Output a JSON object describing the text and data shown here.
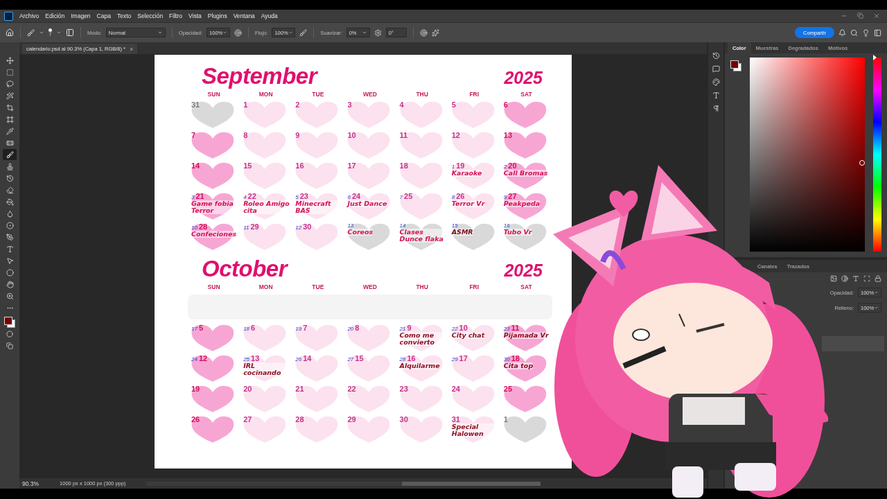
{
  "menu": [
    "Archivo",
    "Edición",
    "Imagen",
    "Capa",
    "Texto",
    "Selección",
    "Filtro",
    "Vista",
    "Plugins",
    "Ventana",
    "Ayuda"
  ],
  "options_bar": {
    "brush_size": "7",
    "mode_label": "Modo:",
    "mode": "Normal",
    "opacity_label": "Opacidad:",
    "opacity": "100%",
    "flow_label": "Flujo:",
    "flow": "100%",
    "smoothing_label": "Suavizar:",
    "smoothing": "0%",
    "angle": "0°",
    "share": "Compartir"
  },
  "document_tab": {
    "title": "calendario.psd al 90.3% (Capa 1, RGB/8) *",
    "close": "×"
  },
  "toolbox": [
    {
      "kind": "move",
      "selected": false
    },
    {
      "kind": "marquee",
      "selected": false
    },
    {
      "kind": "lasso",
      "selected": false
    },
    {
      "kind": "wand",
      "selected": false
    },
    {
      "kind": "crop",
      "selected": false
    },
    {
      "kind": "frame",
      "selected": false
    },
    {
      "kind": "eyedropper",
      "selected": false
    },
    {
      "kind": "healing",
      "selected": false
    },
    {
      "kind": "brush",
      "selected": true
    },
    {
      "kind": "stamp",
      "selected": false
    },
    {
      "kind": "history",
      "selected": false
    },
    {
      "kind": "eraser",
      "selected": false
    },
    {
      "kind": "bucket",
      "selected": false
    },
    {
      "kind": "blur",
      "selected": false
    },
    {
      "kind": "dodge",
      "selected": false
    },
    {
      "kind": "pen",
      "selected": false
    },
    {
      "kind": "type",
      "selected": false
    },
    {
      "kind": "select",
      "selected": false
    },
    {
      "kind": "shape",
      "selected": false
    },
    {
      "kind": "hand",
      "selected": false
    },
    {
      "kind": "zoom",
      "selected": false
    },
    {
      "kind": "more",
      "selected": false
    }
  ],
  "calendar": [
    {
      "name": "September",
      "year": "2025",
      "erased_band": false,
      "weekdays": [
        "SUN",
        "MON",
        "TUE",
        "WED",
        "THU",
        "FRI",
        "SAT"
      ],
      "weeks": [
        {
          "days": [
            {
              "kind": "other",
              "number": "31"
            },
            {
              "kind": "weekday",
              "number": "1"
            },
            {
              "kind": "weekday",
              "number": "2"
            },
            {
              "kind": "weekday",
              "number": "3"
            },
            {
              "kind": "weekday",
              "number": "4"
            },
            {
              "kind": "weekday",
              "number": "5"
            },
            {
              "kind": "weekend",
              "number": "6"
            }
          ]
        },
        {
          "days": [
            {
              "kind": "weekend",
              "number": "7"
            },
            {
              "kind": "weekday",
              "number": "8"
            },
            {
              "kind": "weekday",
              "number": "9"
            },
            {
              "kind": "weekday",
              "number": "10"
            },
            {
              "kind": "weekday",
              "number": "11"
            },
            {
              "kind": "weekday",
              "number": "12"
            },
            {
              "kind": "weekend",
              "number": "13"
            }
          ]
        },
        {
          "days": [
            {
              "kind": "weekend",
              "number": "14"
            },
            {
              "kind": "weekday",
              "number": "15"
            },
            {
              "kind": "weekday",
              "number": "16"
            },
            {
              "kind": "weekday",
              "number": "17"
            },
            {
              "kind": "weekday",
              "number": "18"
            },
            {
              "kind": "weekday",
              "number": "19",
              "mark": "1",
              "note": "Karaoke",
              "color": "#d41356"
            },
            {
              "kind": "weekend",
              "number": "20",
              "mark": "2",
              "note": "Call Bromas",
              "color": "#d41356"
            }
          ]
        },
        {
          "days": [
            {
              "kind": "weekend",
              "number": "21",
              "mark": "3",
              "note": "Game fobia Terror",
              "color": "#d41356"
            },
            {
              "kind": "weekday",
              "number": "22",
              "mark": "4",
              "note": "Roleo Amigo cita",
              "color": "#d41356"
            },
            {
              "kind": "weekday",
              "number": "23",
              "mark": "5",
              "note": "Minecraft BAS",
              "color": "#d41356"
            },
            {
              "kind": "weekday",
              "number": "24",
              "mark": "6",
              "note": "Just Dance",
              "color": "#d41356"
            },
            {
              "kind": "weekday",
              "number": "25",
              "mark": "7"
            },
            {
              "kind": "weekday",
              "number": "26",
              "mark": "8",
              "note": "Terror Vr",
              "color": "#d41356"
            },
            {
              "kind": "weekend",
              "number": "27",
              "mark": "9",
              "note": "Peakpeda",
              "color": "#d41356"
            }
          ]
        },
        {
          "days": [
            {
              "kind": "weekend",
              "number": "28",
              "mark": "10",
              "note": "Confeciones",
              "color": "#d41356"
            },
            {
              "kind": "weekday",
              "number": "29",
              "mark": "11"
            },
            {
              "kind": "weekday",
              "number": "30",
              "mark": "12"
            },
            {
              "kind": "other",
              "mark": "13",
              "note": "Coreos",
              "color": "#d41356"
            },
            {
              "kind": "other",
              "mark": "14",
              "note": "Clases Dunce flaka",
              "color": "#d41356"
            },
            {
              "kind": "other",
              "mark": "15",
              "note": "ASMR",
              "color": "#7a0a1a"
            },
            {
              "kind": "other",
              "mark": "16",
              "note": "Tubo Vr",
              "color": "#d41356"
            }
          ]
        }
      ]
    },
    {
      "name": "October",
      "year": "2025",
      "erased_band": true,
      "weekdays": [
        "SUN",
        "MON",
        "TUE",
        "WED",
        "THU",
        "FRI",
        "SAT"
      ],
      "weeks": [
        {
          "days": [
            {
              "kind": "weekend",
              "number": "5",
              "mark": "17"
            },
            {
              "kind": "weekday",
              "number": "6",
              "mark": "18"
            },
            {
              "kind": "weekday",
              "number": "7",
              "mark": "19"
            },
            {
              "kind": "weekday",
              "number": "8",
              "mark": "20"
            },
            {
              "kind": "weekday",
              "number": "9",
              "mark": "21",
              "note": "Como me convierto",
              "color": "#8b0f1f"
            },
            {
              "kind": "weekday",
              "number": "10",
              "mark": "22",
              "note": "City chat",
              "color": "#8b0f1f"
            },
            {
              "kind": "weekend",
              "number": "11",
              "mark": "23",
              "note": "Pijamada Vr",
              "color": "#8b0f1f"
            }
          ]
        },
        {
          "days": [
            {
              "kind": "weekend",
              "number": "12",
              "mark": "24"
            },
            {
              "kind": "weekday",
              "number": "13",
              "mark": "25",
              "note": "IRL cocinando",
              "color": "#8b0f1f"
            },
            {
              "kind": "weekday",
              "number": "14",
              "mark": "26"
            },
            {
              "kind": "weekday",
              "number": "15",
              "mark": "27"
            },
            {
              "kind": "weekday",
              "number": "16",
              "mark": "28",
              "note": "Alquilarme",
              "color": "#8b0f1f"
            },
            {
              "kind": "weekday",
              "number": "17",
              "mark": "29"
            },
            {
              "kind": "weekend",
              "number": "18",
              "mark": "30",
              "note": "Cita top",
              "color": "#8b0f1f"
            }
          ]
        },
        {
          "days": [
            {
              "kind": "weekend",
              "number": "19"
            },
            {
              "kind": "weekday",
              "number": "20"
            },
            {
              "kind": "weekday",
              "number": "21"
            },
            {
              "kind": "weekday",
              "number": "22"
            },
            {
              "kind": "weekday",
              "number": "23"
            },
            {
              "kind": "weekday",
              "number": "24"
            },
            {
              "kind": "weekend",
              "number": "25"
            }
          ]
        },
        {
          "days": [
            {
              "kind": "weekend",
              "number": "26"
            },
            {
              "kind": "weekday",
              "number": "27"
            },
            {
              "kind": "weekday",
              "number": "28"
            },
            {
              "kind": "weekday",
              "number": "29"
            },
            {
              "kind": "weekday",
              "number": "30"
            },
            {
              "kind": "weekday",
              "number": "31",
              "note": "Special Halowen",
              "color": "#8b0f1f"
            },
            {
              "kind": "other",
              "number": "1"
            }
          ]
        }
      ]
    }
  ],
  "color_panel": {
    "hue_slider": {
      "level": 1
    },
    "tabs": [
      {
        "label": "Color",
        "selected": true
      },
      {
        "label": "Muestras",
        "selected": false
      },
      {
        "label": "Degradados",
        "selected": false
      },
      {
        "label": "Motivos",
        "selected": false
      }
    ]
  },
  "layers_panel": {
    "tabs": [
      {
        "label": "Canales",
        "selected": false
      },
      {
        "label": "Trazados",
        "selected": false
      }
    ],
    "opacity_label": "Opacidad:",
    "opacity": "100%",
    "fill_label": "Relleno:",
    "fill": "100%"
  },
  "status_bar": {
    "zoom": "90.3%",
    "doc_info": "1000 px x 1000 px (300 ppp)"
  }
}
